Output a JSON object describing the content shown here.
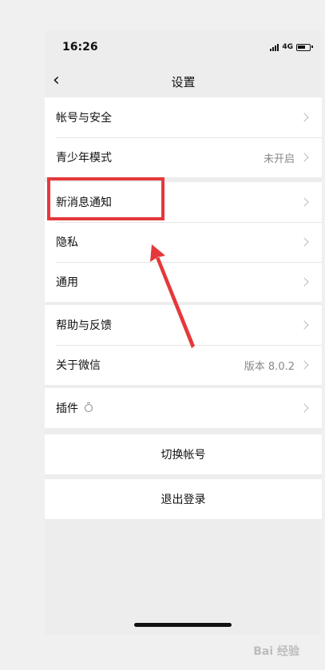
{
  "status": {
    "time": "16:26",
    "network": "4G"
  },
  "nav": {
    "back_icon": "chevron-left-icon",
    "title": "设置"
  },
  "groups": [
    {
      "items": [
        {
          "label": "帐号与安全",
          "value": ""
        },
        {
          "label": "青少年模式",
          "value": "未开启"
        }
      ]
    },
    {
      "items": [
        {
          "label": "新消息通知",
          "value": ""
        },
        {
          "label": "隐私",
          "value": ""
        },
        {
          "label": "通用",
          "value": ""
        }
      ]
    },
    {
      "items": [
        {
          "label": "帮助与反馈",
          "value": ""
        },
        {
          "label": "关于微信",
          "value": "版本 8.0.2"
        }
      ]
    },
    {
      "items": [
        {
          "label": "插件",
          "value": ""
        }
      ]
    }
  ],
  "actions": {
    "switch_account": "切换帐号",
    "logout": "退出登录"
  },
  "annotation": {
    "highlight_color": "#e5383b"
  },
  "watermark": "Bai 经验"
}
